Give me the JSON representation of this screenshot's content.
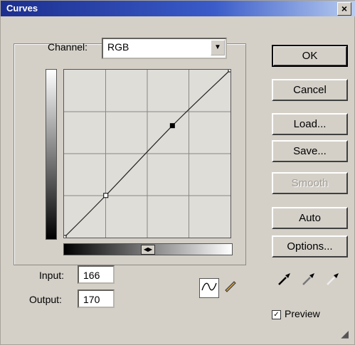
{
  "window": {
    "title": "Curves",
    "close_label": "×"
  },
  "channel": {
    "label": "Channel:",
    "value": "RGB"
  },
  "curve": {
    "points": [
      [
        0,
        0
      ],
      [
        64,
        64
      ],
      [
        166,
        170
      ],
      [
        255,
        255
      ]
    ]
  },
  "input": {
    "label": "Input:",
    "value": "166"
  },
  "output": {
    "label": "Output:",
    "value": "170"
  },
  "buttons": {
    "ok": "OK",
    "cancel": "Cancel",
    "load": "Load...",
    "save": "Save...",
    "smooth": "Smooth",
    "auto": "Auto",
    "options": "Options..."
  },
  "preview": {
    "label": "Preview",
    "checked": true
  },
  "icons": {
    "curve_tool": "curve-tool-icon",
    "pencil_tool": "pencil-tool-icon",
    "black_eyedropper": "black-eyedropper-icon",
    "gray_eyedropper": "gray-eyedropper-icon",
    "white_eyedropper": "white-eyedropper-icon"
  }
}
